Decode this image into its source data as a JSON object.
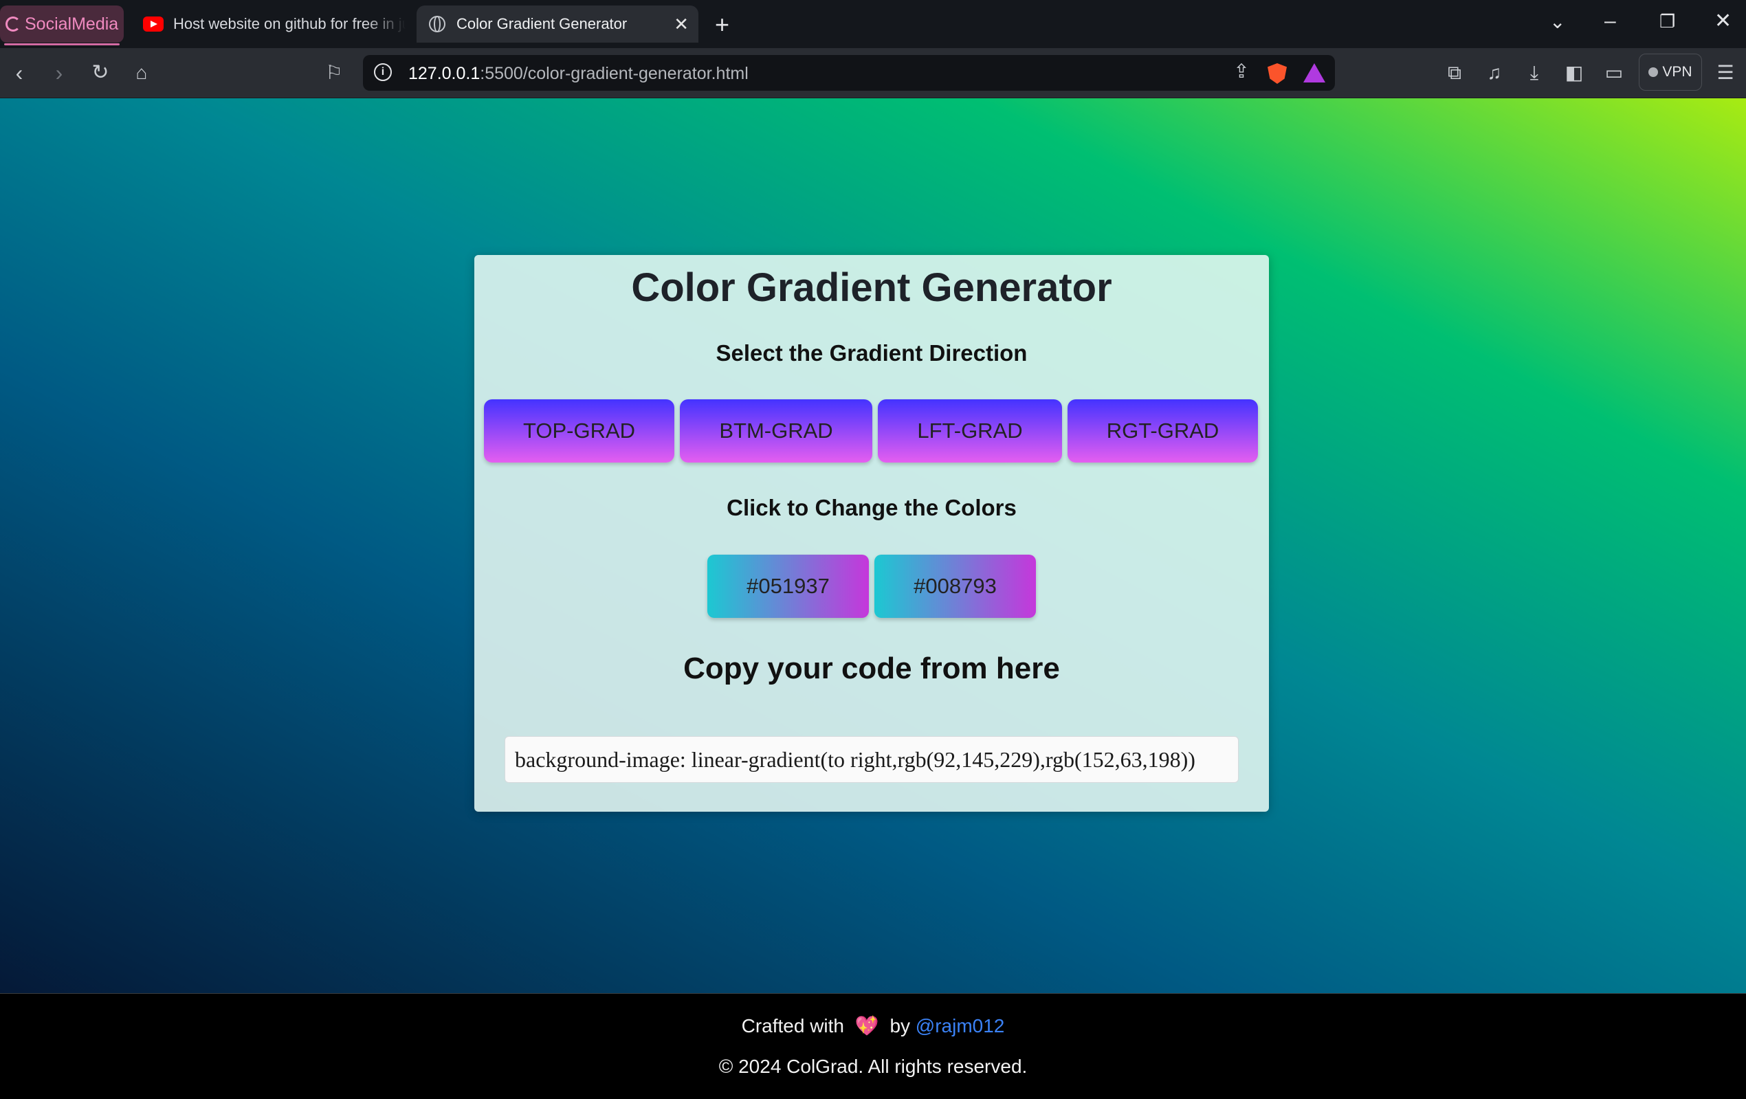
{
  "browser": {
    "tab_group_label": "SocialMedia",
    "tabs": [
      {
        "title": "Host website on github for free in just"
      },
      {
        "title": "Color Gradient Generator"
      }
    ],
    "url_host": "127.0.0.1",
    "url_rest": ":5500/color-gradient-generator.html",
    "vpn_label": "VPN"
  },
  "page": {
    "title": "Color Gradient Generator",
    "direction_heading": "Select the Gradient Direction",
    "direction_buttons": [
      "TOP-GRAD",
      "BTM-GRAD",
      "LFT-GRAD",
      "RGT-GRAD"
    ],
    "color_heading": "Click to Change the Colors",
    "color_buttons": [
      "#051937",
      "#008793"
    ],
    "copy_heading": "Copy your code from here",
    "code_value": "background-image: linear-gradient(to right,rgb(92,145,229),rgb(152,63,198))",
    "background_colors": [
      "#051937",
      "#008793",
      "#00bf72",
      "#a8eb12"
    ]
  },
  "footer": {
    "crafted_prefix": "Crafted with",
    "heart_icon": "heart",
    "crafted_by": "by",
    "author_link": "@rajm012",
    "copyright": "© 2024 ColGrad. All rights reserved."
  }
}
